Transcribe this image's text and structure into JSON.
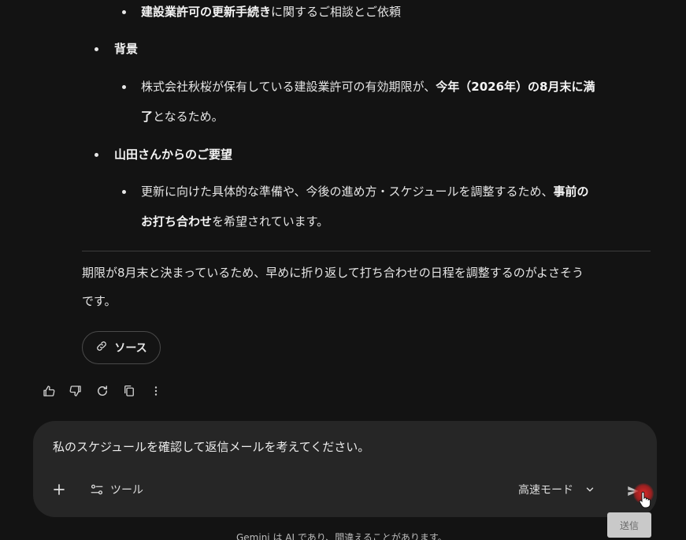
{
  "response": {
    "item1_bullet": {
      "bold": "建設業許可の更新手続き",
      "rest": "に関するご相談とご依頼"
    },
    "heading_background": "背景",
    "background_line1": {
      "pre": "株式会社秋桜が保有している建設業許可の有効期限が、",
      "bold": "今年（2026年）の8月末に満"
    },
    "background_line2": {
      "bold": "了",
      "rest": "となるため。"
    },
    "heading_request": "山田さんからのご要望",
    "request_line1": {
      "pre": "更新に向けた具体的な準備や、今後の進め方・スケジュールを調整するため、",
      "bold": "事前の"
    },
    "request_line2": {
      "bold": "お打ち合わせ",
      "rest": "を希望されています。"
    },
    "summary_line1": "期限が8月末と決まっているため、早めに折り返して打ち合わせの日程を調整するのがよさそう",
    "summary_line2": "です。"
  },
  "source_chip": {
    "label": "ソース",
    "icon": "link-icon"
  },
  "actions": [
    {
      "name": "thumbs-up-icon"
    },
    {
      "name": "thumbs-down-icon"
    },
    {
      "name": "regenerate-icon"
    },
    {
      "name": "copy-icon"
    },
    {
      "name": "more-vert-icon"
    }
  ],
  "composer": {
    "input_value": "私のスケジュールを確認して返信メールを考えてください。",
    "tools_label": "ツール",
    "mode_label": "高速モード",
    "send_tooltip": "送信"
  },
  "footer": {
    "disclaimer": "Gemini は AI であり、間違えることがあります。"
  },
  "colors": {
    "background": "#131313",
    "composer": "#262626",
    "accent_red": "#e02828"
  }
}
